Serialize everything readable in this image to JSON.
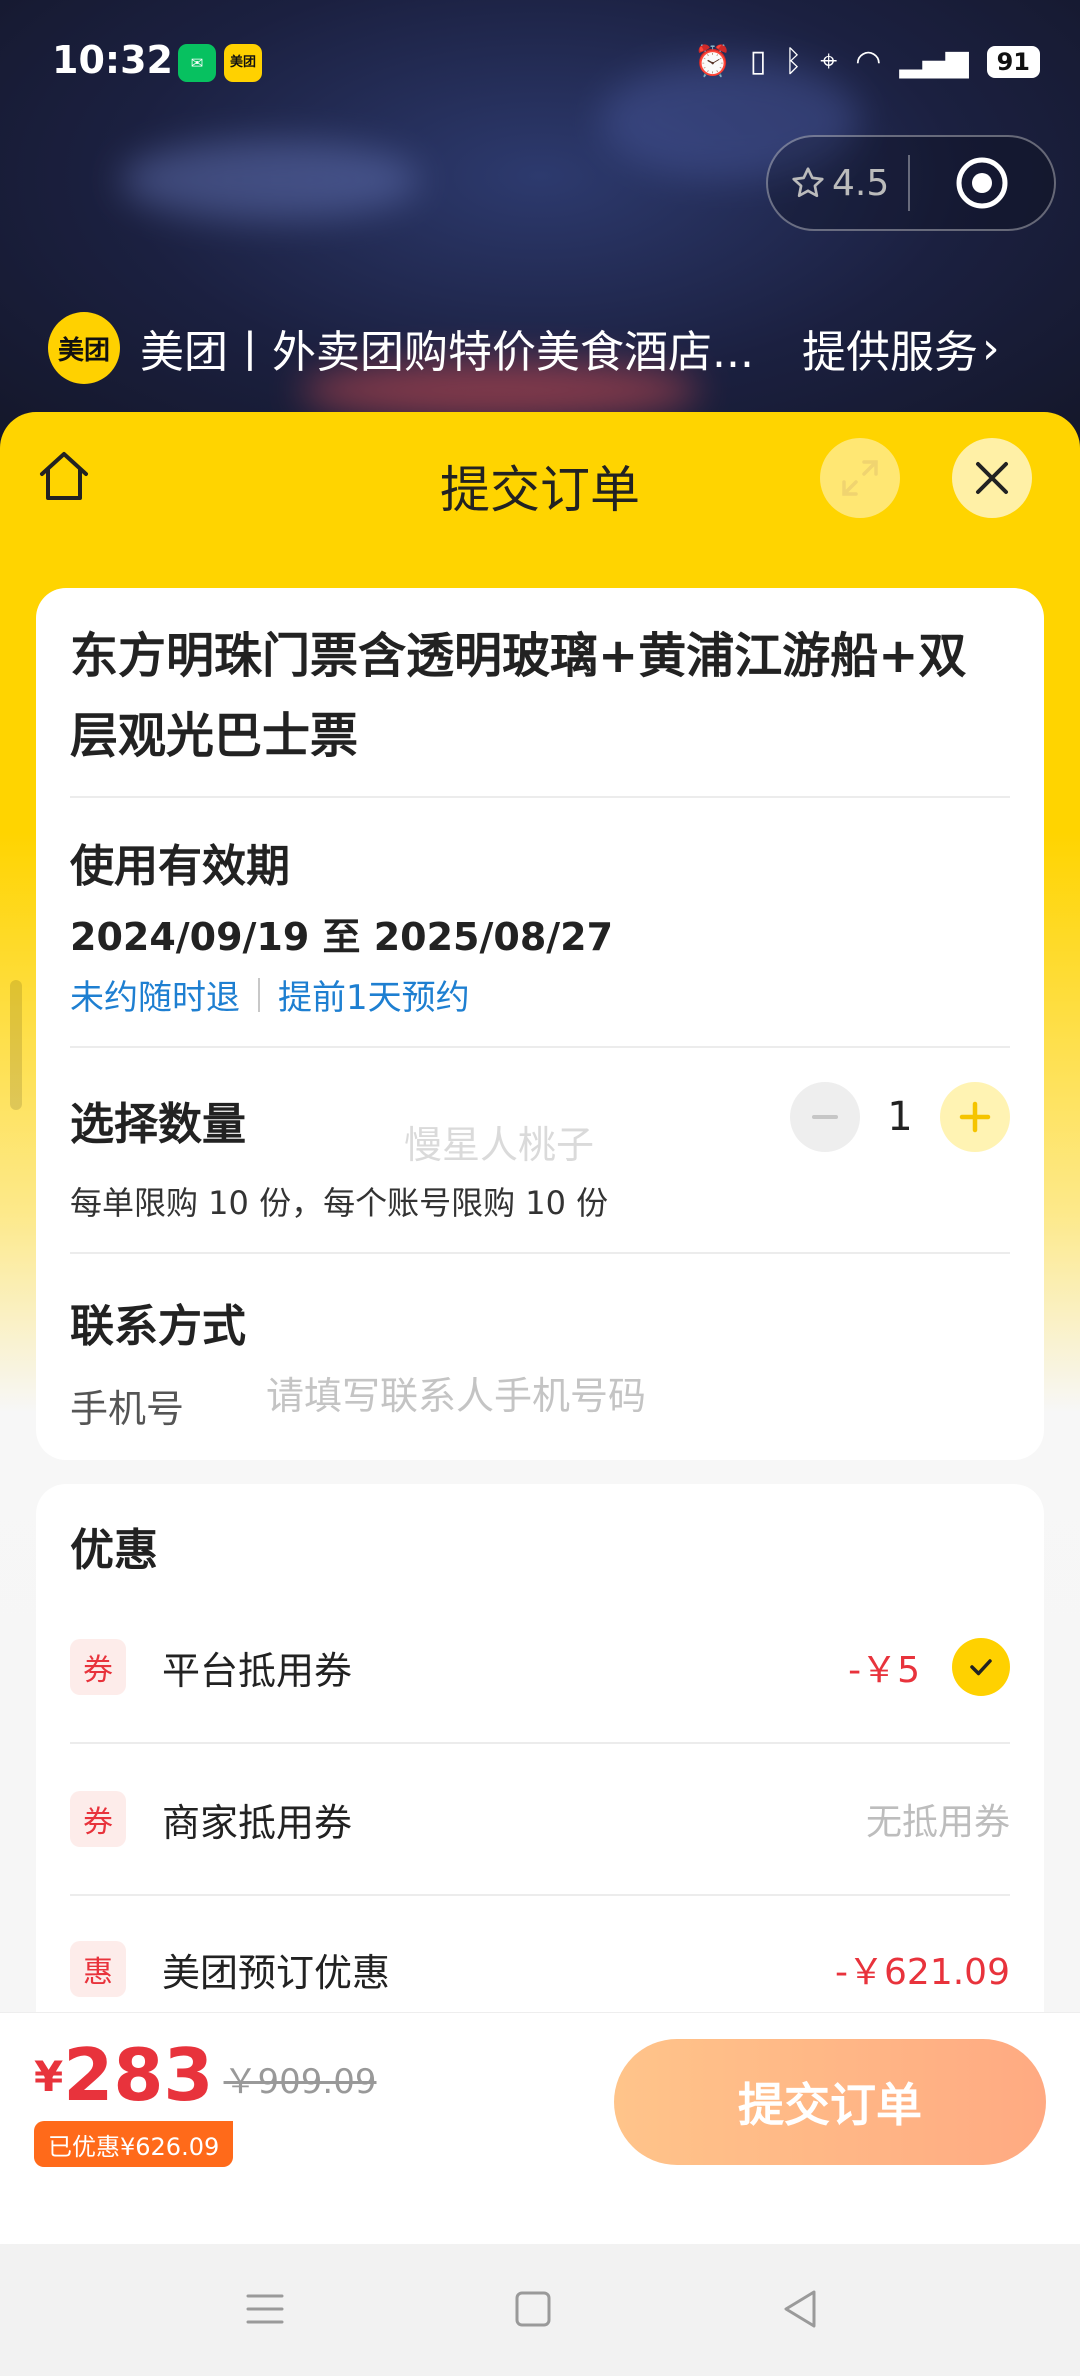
{
  "status_bar": {
    "time": "10:32",
    "battery": "91",
    "app_icon_label": "美团"
  },
  "capsule": {
    "rating": "4.5"
  },
  "provider": {
    "logo_text": "美团",
    "name": "美团丨外卖团购特价美食酒店...",
    "link_label": "提供服务"
  },
  "sheet": {
    "title": "提交订单"
  },
  "product": {
    "title": "东方明珠门票含透明玻璃+黄浦江游船+双层观光巴士票",
    "validity_label": "使用有效期",
    "date_range": "2024/09/19 至 2025/08/27",
    "policy_refund": "未约随时退",
    "policy_booking": "提前1天预约"
  },
  "quantity": {
    "label": "选择数量",
    "value": "1",
    "limit_note": "每单限购 10 份，每个账号限购 10 份",
    "watermark": "慢星人桃子"
  },
  "contact": {
    "label": "联系方式",
    "phone_label": "手机号",
    "phone_placeholder": "请填写联系人手机号码",
    "phone_value": ""
  },
  "discounts": {
    "title": "优惠",
    "items": [
      {
        "tag": "券",
        "name": "平台抵用券",
        "value": "-￥5",
        "selected": true
      },
      {
        "tag": "券",
        "name": "商家抵用券",
        "value": "无抵用券",
        "selected": false
      },
      {
        "tag": "惠",
        "name": "美团预订优惠",
        "value": "-￥621.09",
        "selected": false
      }
    ]
  },
  "footer": {
    "currency": "¥",
    "price": "283",
    "original_price": "￥909.09",
    "saved": "已优惠¥626.09",
    "submit_label": "提交订单"
  },
  "colors": {
    "brand_yellow": "#ffd400",
    "price_red": "#e8333c",
    "link_blue": "#1e7fd1",
    "submit_gradient_start": "#ffc48a",
    "submit_gradient_end": "#ffaa82"
  }
}
